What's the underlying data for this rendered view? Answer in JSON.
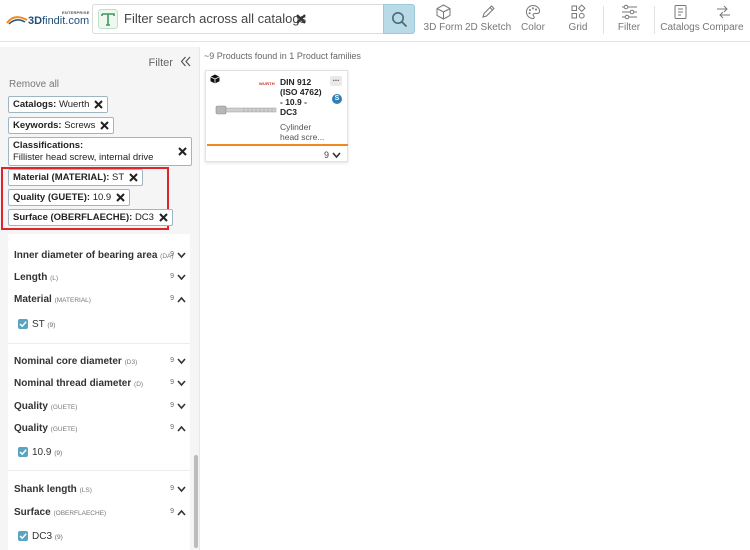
{
  "header": {
    "logo": {
      "enterprise": "ENTERPRISE",
      "brand_bold": "3D",
      "brand_rest": "findit.com"
    },
    "search": {
      "value": "Filter search across all catalogs"
    },
    "tools": [
      {
        "label": "3D Form",
        "icon": "cube-outline-icon"
      },
      {
        "label": "2D Sketch",
        "icon": "pencil-icon"
      },
      {
        "label": "Color",
        "icon": "palette-icon"
      },
      {
        "label": "Grid",
        "icon": "grid-icon"
      },
      {
        "label": "Filter",
        "icon": "sliders-icon"
      },
      {
        "label": "Catalogs",
        "icon": "catalog-icon"
      },
      {
        "label": "Compare",
        "icon": "compare-arrows-icon"
      }
    ]
  },
  "sidebar": {
    "filter_label": "Filter",
    "remove_all": "Remove all",
    "chips": [
      {
        "key": "Catalogs:",
        "value": "Wuerth"
      },
      {
        "key": "Keywords:",
        "value": "Screws"
      },
      {
        "key": "Classifications:",
        "value": "Fillister head screw, internal drive"
      },
      {
        "key": "Material (MATERIAL):",
        "value": "ST"
      },
      {
        "key": "Quality (GUETE):",
        "value": "10.9"
      },
      {
        "key": "Surface (OBERFLAECHE):",
        "value": "DC3"
      }
    ],
    "facets": [
      {
        "label": "Inner diameter of bearing area",
        "code": "(DA)",
        "count": "9"
      },
      {
        "label": "Length",
        "code": "(L)",
        "count": "9"
      },
      {
        "label": "Material",
        "code": "(MATERIAL)",
        "count": "9",
        "option": "ST",
        "option_count": "(9)"
      },
      {
        "label": "Nominal core diameter",
        "code": "(D3)",
        "count": "9"
      },
      {
        "label": "Nominal thread diameter",
        "code": "(D)",
        "count": "9"
      },
      {
        "label": "Quality",
        "code": "(GUETE)",
        "count": "9"
      },
      {
        "label": "Quality",
        "code": "(GUETE)",
        "count": "9",
        "option": "10.9",
        "option_count": "(9)"
      },
      {
        "label": "Shank length",
        "code": "(LS)",
        "count": "9"
      },
      {
        "label": "Surface",
        "code": "(OBERFLAECHE)",
        "count": "9",
        "option": "DC3",
        "option_count": "(9)"
      }
    ]
  },
  "main": {
    "results": "~9 Products found in 1 Product families",
    "card": {
      "brand": "WURTH",
      "title": "DIN 912 (ISO 4762) - 10.9 - DC3",
      "description": "Cylinder head scre...",
      "more": "...",
      "badge": "S",
      "count": "9"
    }
  },
  "colors": {
    "accent": "#5aa4c3",
    "search_button": "#b9dbe8",
    "highlight": "#e0242b",
    "card_bar": "#f08a1c"
  }
}
